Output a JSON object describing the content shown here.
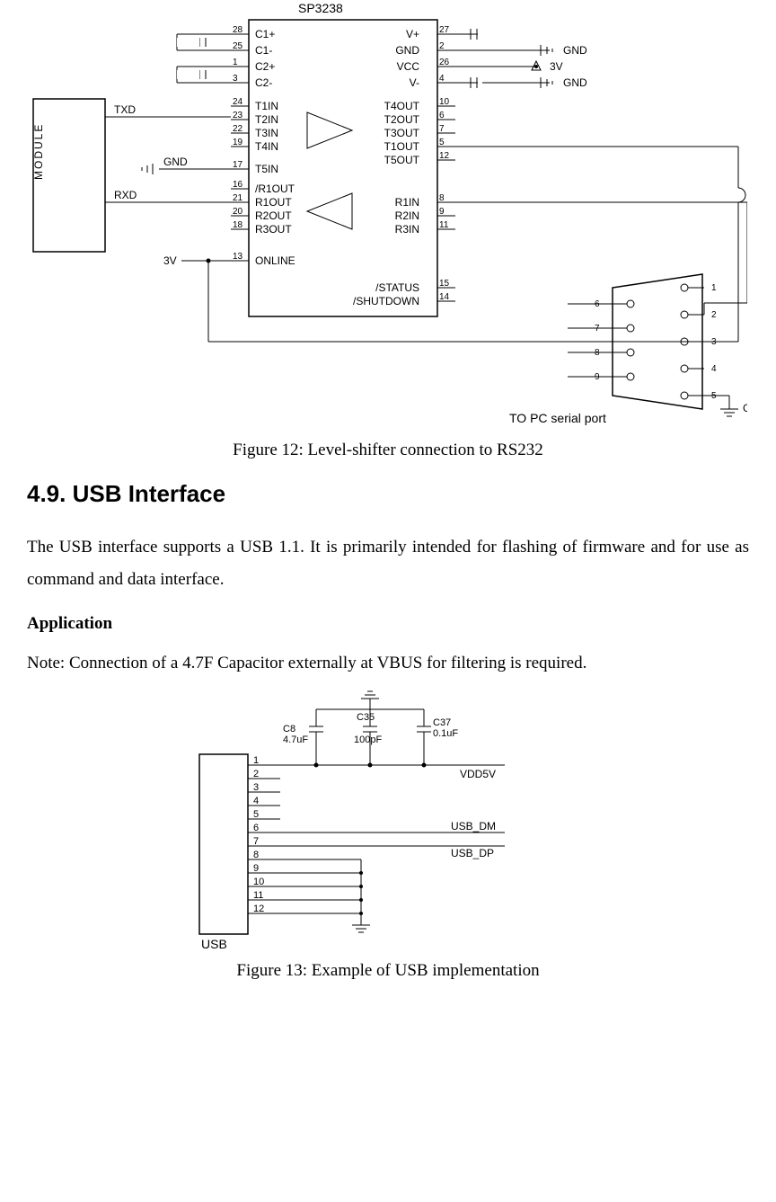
{
  "fig12": {
    "ic_name": "SP3238",
    "module_label": "MODULE",
    "module_pins": {
      "txd": "TXD",
      "gnd": "GND",
      "rxd": "RXD",
      "vcc": "3V"
    },
    "ext_labels": {
      "gnd": "GND",
      "v3": "3V",
      "to_pc": "TO PC serial port"
    },
    "left_pins": [
      {
        "num": "28",
        "name": "C1+"
      },
      {
        "num": "25",
        "name": "C1-"
      },
      {
        "num": "1",
        "name": "C2+"
      },
      {
        "num": "3",
        "name": "C2-"
      },
      {
        "num": "24",
        "name": "T1IN"
      },
      {
        "num": "23",
        "name": "T2IN"
      },
      {
        "num": "22",
        "name": "T3IN"
      },
      {
        "num": "19",
        "name": "T4IN"
      },
      {
        "num": "17",
        "name": "T5IN"
      },
      {
        "num": "16",
        "name": "/R1OUT"
      },
      {
        "num": "21",
        "name": "R1OUT"
      },
      {
        "num": "20",
        "name": "R2OUT"
      },
      {
        "num": "18",
        "name": "R3OUT"
      },
      {
        "num": "13",
        "name": "ONLINE"
      }
    ],
    "right_pins": [
      {
        "num": "27",
        "name": "V+"
      },
      {
        "num": "2",
        "name": "GND"
      },
      {
        "num": "26",
        "name": "VCC"
      },
      {
        "num": "4",
        "name": "V-"
      },
      {
        "num": "10",
        "name": "T4OUT"
      },
      {
        "num": "6",
        "name": "T2OUT"
      },
      {
        "num": "7",
        "name": "T3OUT"
      },
      {
        "num": "5",
        "name": "T1OUT"
      },
      {
        "num": "12",
        "name": "T5OUT"
      },
      {
        "num": "8",
        "name": "R1IN"
      },
      {
        "num": "9",
        "name": "R2IN"
      },
      {
        "num": "11",
        "name": "R3IN"
      },
      {
        "num": "15",
        "name": "/STATUS"
      },
      {
        "num": "14",
        "name": "/SHUTDOWN"
      }
    ],
    "db9": {
      "left": [
        "6",
        "7",
        "8",
        "9"
      ],
      "right": [
        "1",
        "2",
        "3",
        "4",
        "5"
      ]
    },
    "caption": "Figure 12: Level-shifter connection to RS232"
  },
  "section": {
    "heading": "4.9. USB Interface",
    "para1": "The USB interface supports a USB 1.1. It is primarily intended for flashing of firmware and for use as command and data interface.",
    "subhead": "Application",
    "note": "Note: Connection of a 4.7F Capacitor externally at VBUS for filtering is required."
  },
  "fig13": {
    "connector_label": "USB",
    "caps": {
      "c8_ref": "C8",
      "c8_val": "4.7uF",
      "c35_ref": "C35",
      "c35_val": "100pF",
      "c37_ref": "C37",
      "c37_val": "0.1uF"
    },
    "nets": {
      "vdd5v": "VDD5V",
      "usb_dm": "USB_DM",
      "usb_dp": "USB_DP"
    },
    "pins": [
      "1",
      "2",
      "3",
      "4",
      "5",
      "6",
      "7",
      "8",
      "9",
      "10",
      "11",
      "12"
    ],
    "caption": "Figure 13: Example of USB implementation"
  }
}
